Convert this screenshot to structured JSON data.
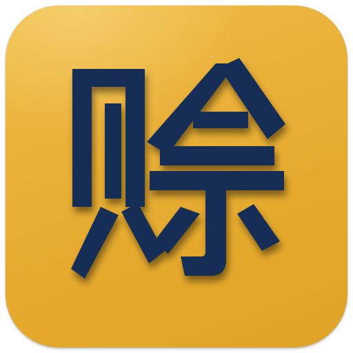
{
  "icon": {
    "character": "赊",
    "background_color": "#e8ac31",
    "glyph_color": "#142f55",
    "glyph_shadow_color": "#8a5e10"
  }
}
